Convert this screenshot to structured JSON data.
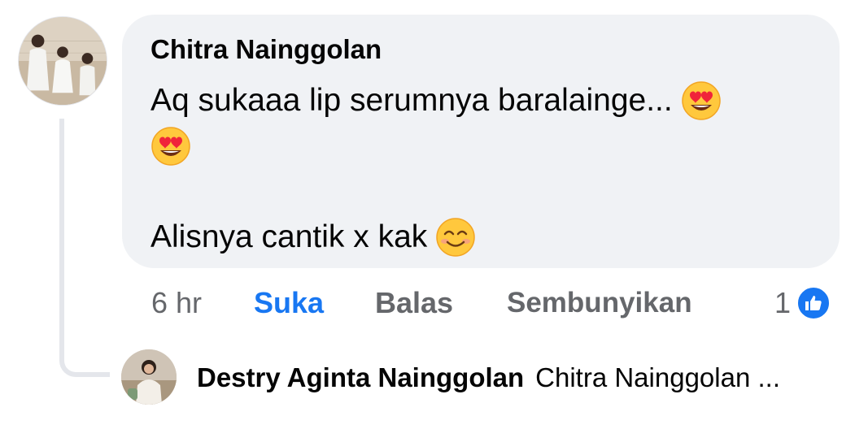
{
  "comment": {
    "author": "Chitra Nainggolan",
    "lines": [
      "Aq sukaaa lip serumnya baralainge...",
      "",
      "",
      "Alisnya cantik x kak"
    ],
    "emojis": [
      "heart-eyes-emoji",
      "heart-eyes-emoji",
      "smiling-face-emoji"
    ],
    "time": "6 hr",
    "like_label": "Suka",
    "reply_label": "Balas",
    "hide_label": "Sembunyikan",
    "reaction_count": "1",
    "reaction_icon": "thumbs-up-icon"
  },
  "reply": {
    "author": "Destry Aginta Nainggolan",
    "snippet": "Chitra Nainggolan ..."
  },
  "colors": {
    "bubble": "#f0f2f5",
    "accent": "#1877f2",
    "secondary_text": "#65676b",
    "primary_text": "#050505",
    "thread_line": "#e4e6eb"
  }
}
